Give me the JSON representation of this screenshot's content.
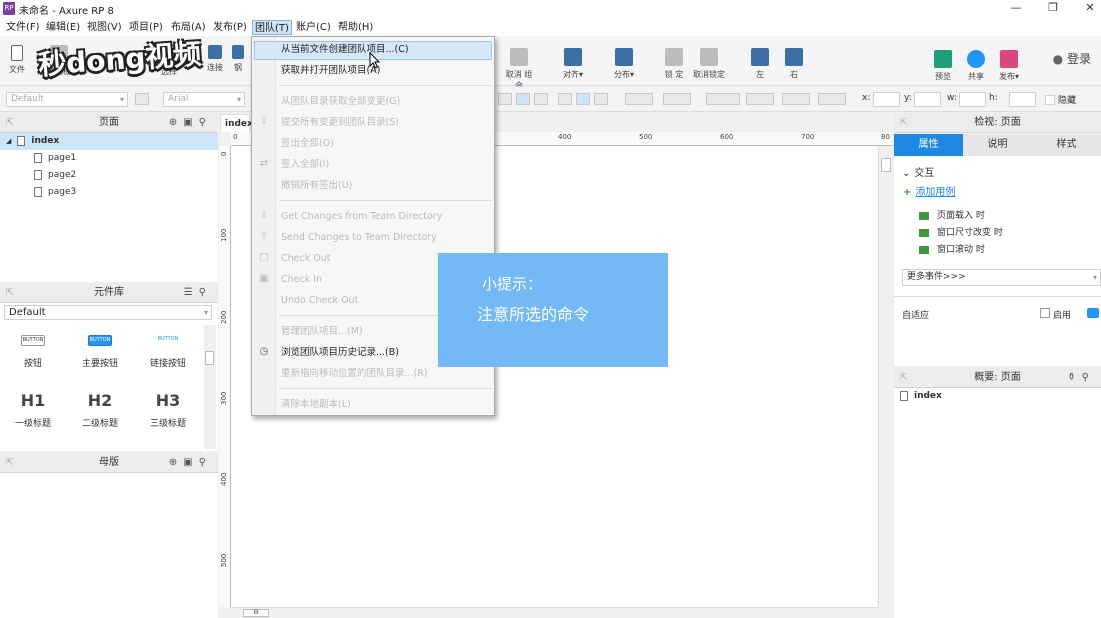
{
  "window": {
    "title": "未命名 - Axure RP 8",
    "logo": "RP",
    "controls": [
      "—",
      "❐",
      "✕"
    ]
  },
  "watermark": "秒dong视频",
  "menubar": {
    "items": [
      "文件(F)",
      "编辑(E)",
      "视图(V)",
      "项目(P)",
      "布局(A)",
      "发布(P)",
      "团队(T)",
      "账户(C)",
      "帮助(H)"
    ],
    "active_index": 6
  },
  "toolbar": {
    "left_labels": [
      "文件",
      "剪贴板",
      "选择",
      "连接",
      "钢"
    ],
    "mid_labels": [
      "取消 组合",
      "对齐▾",
      "分布▾",
      "锁 定",
      "取消锁定",
      "左",
      "右"
    ],
    "right_labels": [
      "预览",
      "共享",
      "发布▾"
    ],
    "login": "登录"
  },
  "formatbar": {
    "style_select": "Default",
    "font_select": "Arial",
    "x_label": "x:",
    "y_label": "y:",
    "w_label": "w:",
    "h_label": "h:",
    "hide_label": "隐藏"
  },
  "pages_panel": {
    "title": "页面",
    "root": "index",
    "children": [
      "page1",
      "page2",
      "page3"
    ]
  },
  "library_panel": {
    "title": "元件库",
    "selected": "Default",
    "widgets": [
      {
        "preview": "BUTTON",
        "label": "按钮"
      },
      {
        "preview": "BUTTON",
        "label": "主要按钮"
      },
      {
        "preview": "BUTTON",
        "label": "链接按钮"
      },
      {
        "preview": "H1",
        "label": "一级标题"
      },
      {
        "preview": "H2",
        "label": "二级标题"
      },
      {
        "preview": "H3",
        "label": "三级标题"
      }
    ]
  },
  "master_panel": {
    "title": "母版"
  },
  "canvas": {
    "tab": "index",
    "hruler": [
      "0",
      "400",
      "500",
      "600",
      "700",
      "80"
    ],
    "vruler": [
      "0",
      "100",
      "200",
      "300",
      "400",
      "500"
    ],
    "hscroll_thumb": "III"
  },
  "team_menu": {
    "items": [
      {
        "label": "从当前文件创建团队项目...(C)",
        "enabled": true
      },
      {
        "label": "获取并打开团队项目(A)",
        "enabled": true
      },
      {
        "label": "从团队目录获取全部变更(G)",
        "enabled": false
      },
      {
        "label": "提交所有变更到团队目录(S)",
        "enabled": false
      },
      {
        "label": "签出全部(O)",
        "enabled": false
      },
      {
        "label": "签入全部(I)",
        "enabled": false
      },
      {
        "label": "撤销所有签出(U)",
        "enabled": false
      },
      {
        "label": "Get Changes from Team Directory",
        "enabled": false
      },
      {
        "label": "Send Changes to Team Directory",
        "enabled": false
      },
      {
        "label": "Check Out",
        "enabled": false
      },
      {
        "label": "Check In",
        "enabled": false
      },
      {
        "label": "Undo Check Out",
        "enabled": false
      },
      {
        "label": "管理团队项目...(M)",
        "enabled": false
      },
      {
        "label": "浏览团队项目历史记录...(B)",
        "enabled": true
      },
      {
        "label": "重新指向移动位置的团队目录...(R)",
        "enabled": false
      },
      {
        "label": "清除本地副本(L)",
        "enabled": false
      }
    ]
  },
  "tip": {
    "title": "小提示：",
    "body": "注意所选的命令"
  },
  "inspector": {
    "title": "检视: 页面",
    "tabs": [
      "属性",
      "说明",
      "样式"
    ],
    "section": "交互",
    "add_case": "添加用例",
    "events": [
      "页面载入 时",
      "窗口尺寸改变 时",
      "窗口滚动 时"
    ],
    "more_events": "更多事件>>>",
    "adaptive_label": "自适应",
    "enable_label": "启用"
  },
  "outline": {
    "title": "概要: 页面",
    "item": "index"
  },
  "colors": {
    "accent": "#1e88e5",
    "tip_bg": "#73b8f7",
    "menu_highlight": "#d6e8f8"
  }
}
